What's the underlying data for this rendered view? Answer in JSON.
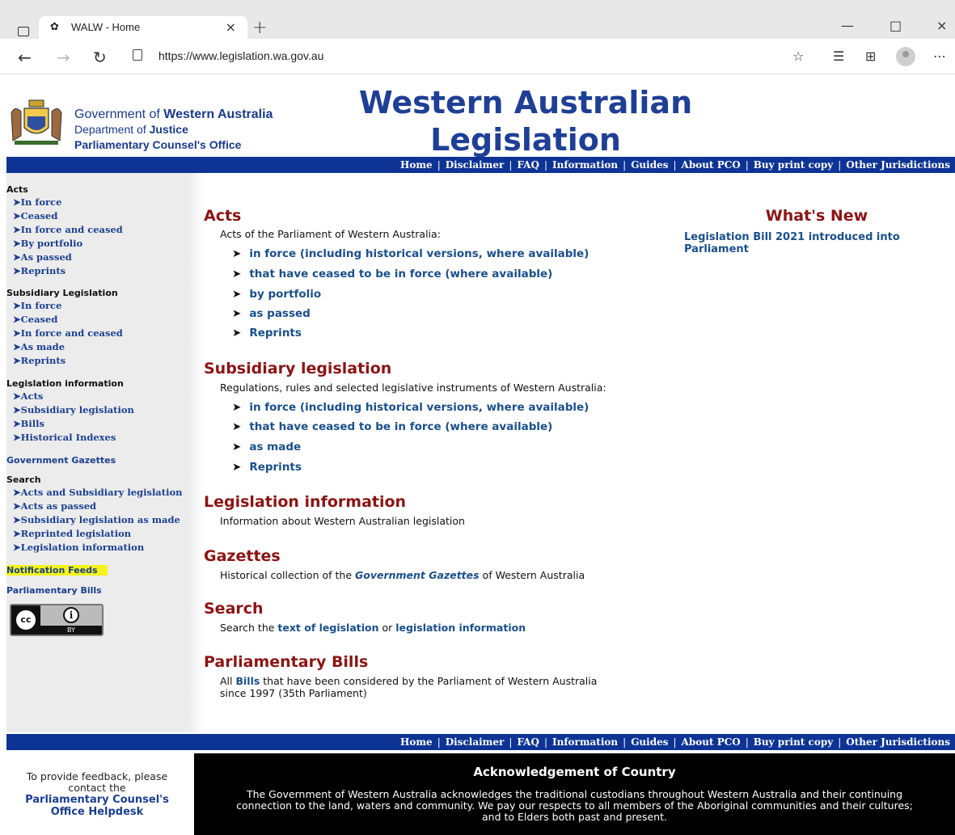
{
  "browser": {
    "tab_title": "WALW - Home",
    "url": "https://www.legislation.wa.gov.au"
  },
  "header": {
    "gov_line1_prefix": "Government of ",
    "gov_line1_bold": "Western Australia",
    "gov_line2_prefix": "Department of ",
    "gov_line2_bold": "Justice",
    "gov_line3": "Parliamentary Counsel's Office",
    "brand_line1": "Western Australian",
    "brand_line2": "Legislation"
  },
  "nav": {
    "items": [
      "Home",
      "Disclaimer",
      "FAQ",
      "Information",
      "Guides",
      "About PCO",
      "Buy print copy",
      "Other Jurisdictions"
    ]
  },
  "sidebar": {
    "acts_head": "Acts",
    "acts": [
      "In force",
      "Ceased",
      "In force and ceased",
      "By portfolio",
      "As passed",
      "Reprints"
    ],
    "sub_head": "Subsidiary Legislation",
    "sub": [
      "In force",
      "Ceased",
      "In force and ceased",
      "As made",
      "Reprints"
    ],
    "info_head": "Legislation information",
    "info": [
      "Acts",
      "Subsidiary legislation",
      "Bills",
      "Historical Indexes"
    ],
    "gazettes": "Government Gazettes",
    "search_head": "Search",
    "search": [
      "Acts and Subsidiary legislation",
      "Acts as passed",
      "Subsidiary legislation as made",
      "Reprinted legislation",
      "Legislation information"
    ],
    "feeds": "Notification Feeds",
    "bills": "Parliamentary Bills",
    "cc_label": "cc",
    "cc_by": "BY"
  },
  "main": {
    "acts_title": "Acts",
    "acts_desc": "Acts of the Parliament of Western Australia:",
    "acts_links": [
      "in force (including historical versions, where available)",
      "that have ceased to be in force (where available)",
      "by portfolio",
      "as passed",
      "Reprints"
    ],
    "sub_title": "Subsidiary legislation",
    "sub_desc": "Regulations, rules and selected legislative instruments of Western Australia:",
    "sub_links": [
      "in force (including historical versions, where available)",
      "that have ceased to be in force (where available)",
      "as made",
      "Reprints"
    ],
    "info_title": "Legislation information",
    "info_desc": "Information about Western Australian legislation",
    "gaz_title": "Gazettes",
    "gaz_desc_pre": "Historical collection of the ",
    "gaz_desc_link": "Government Gazettes",
    "gaz_desc_post": " of Western Australia",
    "search_title": "Search",
    "search_pre": "Search the ",
    "search_link1": "text of legislation",
    "search_mid": " or ",
    "search_link2": "legislation information",
    "bills_title": "Parliamentary Bills",
    "bills_pre": "All ",
    "bills_link": "Bills",
    "bills_post1": " that have been considered by the Parliament of Western Australia",
    "bills_post2": "since 1997 (35th Parliament)"
  },
  "whats_new": {
    "title": "What's New",
    "item": "Legislation Bill 2021 introduced into Parliament"
  },
  "footer": {
    "feedback_1": "To provide feedback, please",
    "feedback_2": "contact the",
    "feedback_link_1": "Parliamentary Counsel's",
    "feedback_link_2": "Office Helpdesk",
    "ack_title": "Acknowledgement of Country",
    "ack_line1": "The Government of Western Australia acknowledges the traditional custodians throughout Western Australia and their continuing",
    "ack_line2": "connection to the land, waters and community. We pay our respects to all members of the Aboriginal communities and their cultures;",
    "ack_line3": "and to Elders both past and present."
  }
}
